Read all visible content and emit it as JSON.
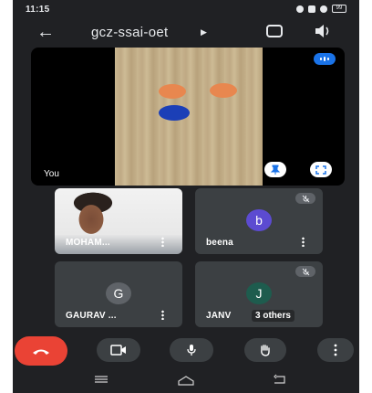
{
  "status": {
    "time": "11:15",
    "battery": "99"
  },
  "header": {
    "title": "gcz-ssai-oet"
  },
  "main": {
    "self_label": "You"
  },
  "participants": [
    {
      "name": "MOHAM...",
      "has_video": true
    },
    {
      "name": "beena",
      "initial": "b",
      "avatar_color": "#5c4bd1"
    },
    {
      "name": "GAURAV ...",
      "initial": "G",
      "avatar_color": "#5f6368"
    },
    {
      "name": "JANV",
      "initial": "J",
      "avatar_color": "#1e5c4e",
      "overlay": "3 others"
    }
  ],
  "colors": {
    "accent": "#1a73e8",
    "end_call": "#ea4335",
    "background": "#202124",
    "tile": "#3c4043"
  }
}
